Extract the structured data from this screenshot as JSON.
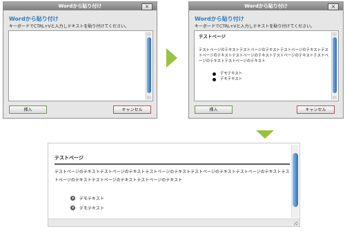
{
  "dialog": {
    "window_title": "Wordから貼り付け",
    "close_label": "✕",
    "title": "Wordから貼り付け",
    "instruction": "キーボードでCTRL+Vと入力しテキストを貼り付けてください。",
    "insert_label": "挿入",
    "cancel_label": "キャンセル"
  },
  "pasted": {
    "heading": "テストページ",
    "body": "テストページのテキストテストページのテキストテストページのテキストテストページのテキストテストページのテキストテストページのテキストテストページのテキストテストページのテキスト",
    "bullets": [
      "デモテキスト",
      "デモテキスト"
    ]
  },
  "editor": {
    "heading": "テストページ",
    "body": "テストページのテキストテストページのテキストテストページのテキストテストページのテキストテストページのテキストテストページのテキストテストページのテキストテストページのテキスト",
    "bullets": [
      "デモテキスト",
      "デモテキスト"
    ]
  },
  "colors": {
    "accent": "#2f78b7",
    "arrow": "#97c33e",
    "insert_border": "#6a9b4a",
    "cancel_border": "#b94f46"
  },
  "icons": [
    "close-icon",
    "arrow-right-icon",
    "arrow-down-icon",
    "bullet-circle-icon",
    "resize-grip-icon"
  ]
}
